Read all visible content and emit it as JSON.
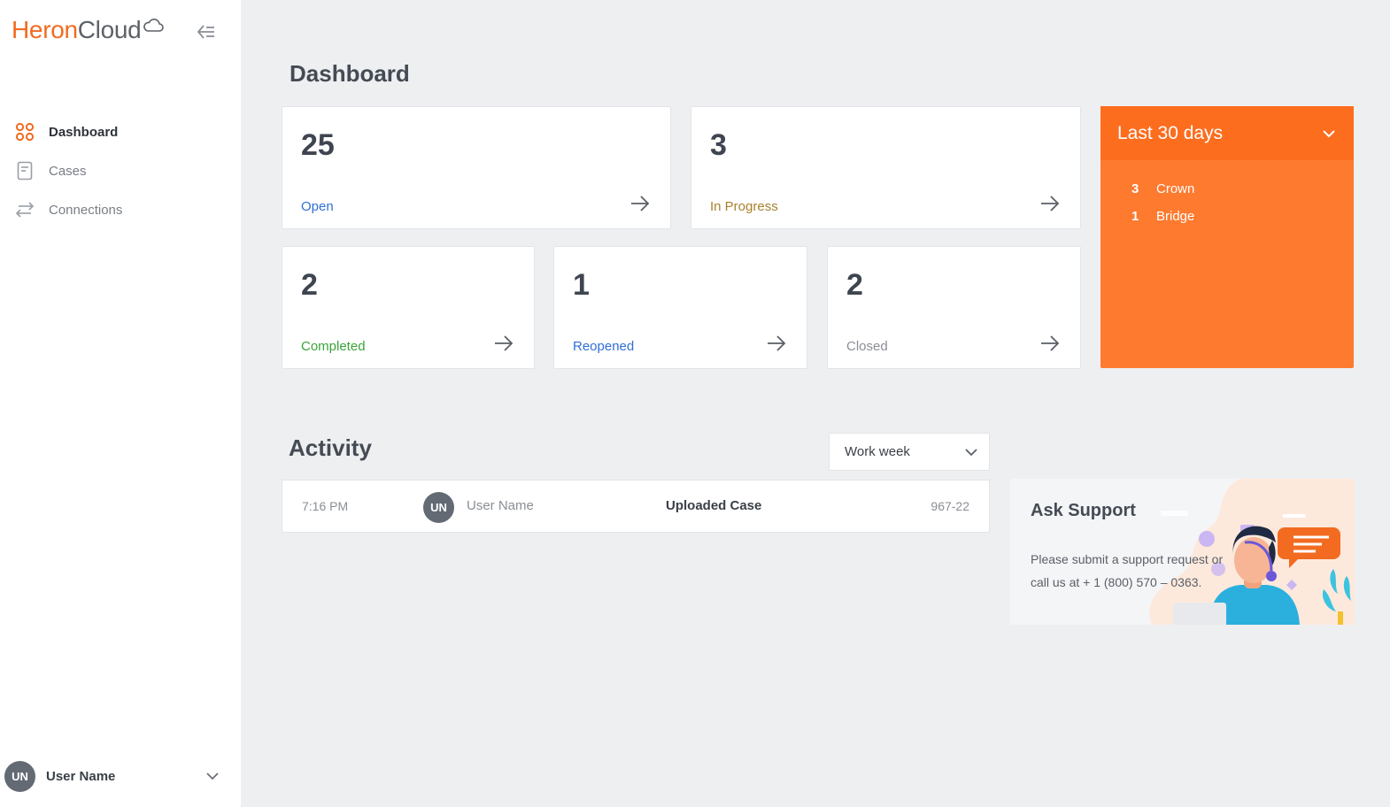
{
  "app": {
    "logo_part1": "Heron",
    "logo_part2": "Cloud"
  },
  "sidebar": {
    "items": [
      {
        "label": "Dashboard",
        "icon": "dashboard-grid-icon",
        "active": true
      },
      {
        "label": "Cases",
        "icon": "document-icon",
        "active": false
      },
      {
        "label": "Connections",
        "icon": "swap-arrows-icon",
        "active": false
      }
    ],
    "user": {
      "initials": "UN",
      "name": "User Name"
    }
  },
  "dashboard": {
    "title": "Dashboard",
    "cards": [
      {
        "count": "25",
        "label": "Open",
        "color": "#2f6fd6"
      },
      {
        "count": "3",
        "label": "In Progress",
        "color": "#a8812e"
      },
      {
        "count": "2",
        "label": "Completed",
        "color": "#3aa53a"
      },
      {
        "count": "1",
        "label": "Reopened",
        "color": "#2f6fd6"
      },
      {
        "count": "2",
        "label": "Closed",
        "color": "#8a8e95"
      }
    ],
    "period": {
      "label": "Last 30 days",
      "rows": [
        {
          "count": "3",
          "name": "Crown"
        },
        {
          "count": "1",
          "name": "Bridge"
        }
      ]
    }
  },
  "activity": {
    "title": "Activity",
    "filter": "Work week",
    "rows": [
      {
        "time": "7:16 PM",
        "initials": "UN",
        "user": "User Name",
        "action": "Uploaded Case",
        "ref": "967-22"
      }
    ]
  },
  "support": {
    "title": "Ask Support",
    "text": "Please submit a support request or call us at + 1 (800) 570 – 0363."
  },
  "colors": {
    "brand": "#f26b21",
    "orange_panel": "#fd7a2f",
    "background": "#eeeff1"
  }
}
